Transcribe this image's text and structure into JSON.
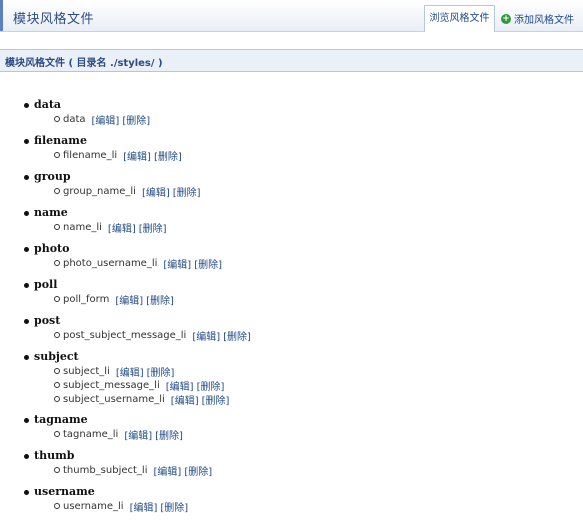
{
  "header": {
    "title": "模块风格文件",
    "tab_browse": "浏览风格文件",
    "add_label": "添加风格文件"
  },
  "section": {
    "title": "模块风格文件 ( 目录名 ./styles/ )"
  },
  "actions": {
    "edit": "[编辑]",
    "delete": "[删除]"
  },
  "groups": [
    {
      "name": "data",
      "items": [
        "data"
      ]
    },
    {
      "name": "filename",
      "items": [
        "filename_li"
      ]
    },
    {
      "name": "group",
      "items": [
        "group_name_li"
      ]
    },
    {
      "name": "name",
      "items": [
        "name_li"
      ]
    },
    {
      "name": "photo",
      "items": [
        "photo_username_li"
      ]
    },
    {
      "name": "poll",
      "items": [
        "poll_form"
      ]
    },
    {
      "name": "post",
      "items": [
        "post_subject_message_li"
      ]
    },
    {
      "name": "subject",
      "items": [
        "subject_li",
        "subject_message_li",
        "subject_username_li"
      ]
    },
    {
      "name": "tagname",
      "items": [
        "tagname_li"
      ]
    },
    {
      "name": "thumb",
      "items": [
        "thumb_subject_li"
      ]
    },
    {
      "name": "username",
      "items": [
        "username_li"
      ]
    }
  ]
}
